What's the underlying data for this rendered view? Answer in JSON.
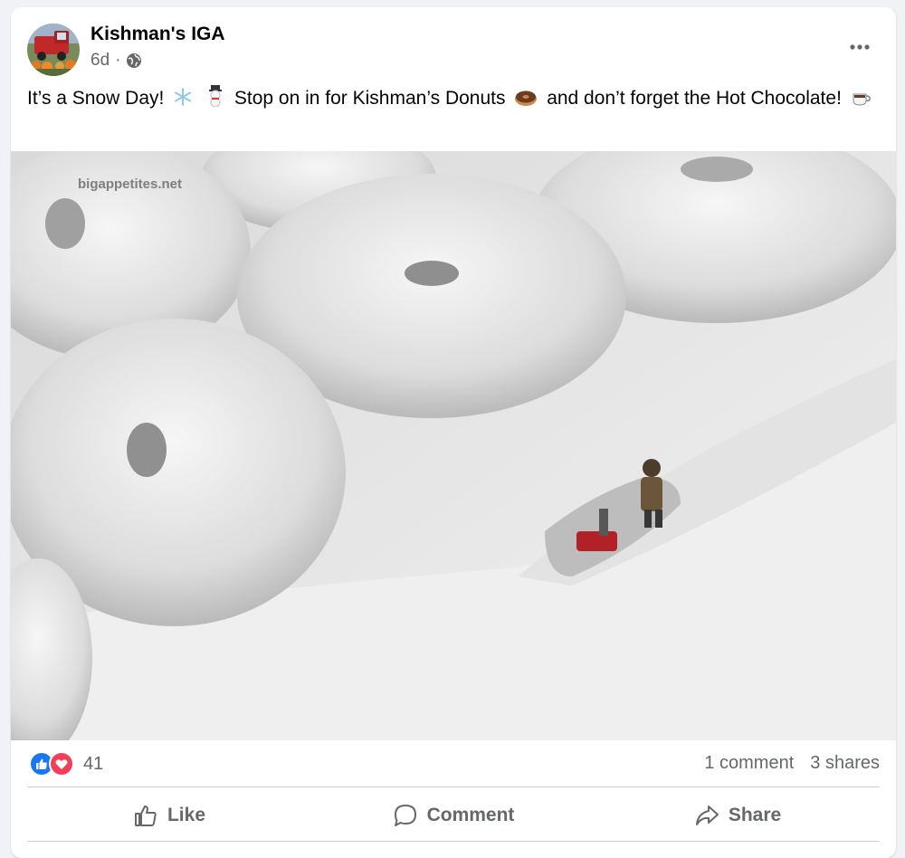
{
  "post": {
    "author": "Kishman's IGA",
    "time": "6d",
    "separator": "·",
    "audience_icon": "globe-icon",
    "text_part1": "It’s a Snow Day!",
    "text_part2": "Stop on in for Kishman’s Donuts",
    "text_part3": "and don’t forget the  Hot Chocolate!",
    "emojis": [
      "snowflake-icon",
      "snowman-icon",
      "donut-icon",
      "hot-beverage-icon"
    ],
    "image": {
      "watermark": "bigappetites.net",
      "description_icon": "powdered-donuts-photo"
    }
  },
  "engagement": {
    "reaction_icons": [
      "like-icon",
      "love-icon"
    ],
    "reaction_count": "41",
    "comments": "1 comment",
    "shares": "3 shares"
  },
  "actions": {
    "like": "Like",
    "comment": "Comment",
    "share": "Share"
  },
  "colors": {
    "like_blue": "#1877f2",
    "love_red": "#f33e58",
    "secondary_text": "#65676b"
  }
}
